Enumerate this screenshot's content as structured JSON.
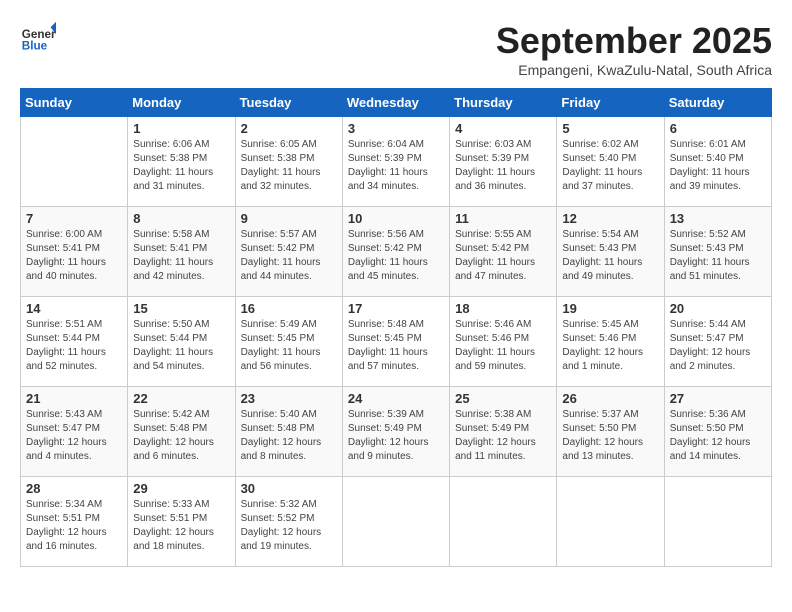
{
  "header": {
    "logo_general": "General",
    "logo_blue": "Blue",
    "month_title": "September 2025",
    "subtitle": "Empangeni, KwaZulu-Natal, South Africa"
  },
  "days_of_week": [
    "Sunday",
    "Monday",
    "Tuesday",
    "Wednesday",
    "Thursday",
    "Friday",
    "Saturday"
  ],
  "weeks": [
    [
      {
        "day": "",
        "info": ""
      },
      {
        "day": "1",
        "info": "Sunrise: 6:06 AM\nSunset: 5:38 PM\nDaylight: 11 hours\nand 31 minutes."
      },
      {
        "day": "2",
        "info": "Sunrise: 6:05 AM\nSunset: 5:38 PM\nDaylight: 11 hours\nand 32 minutes."
      },
      {
        "day": "3",
        "info": "Sunrise: 6:04 AM\nSunset: 5:39 PM\nDaylight: 11 hours\nand 34 minutes."
      },
      {
        "day": "4",
        "info": "Sunrise: 6:03 AM\nSunset: 5:39 PM\nDaylight: 11 hours\nand 36 minutes."
      },
      {
        "day": "5",
        "info": "Sunrise: 6:02 AM\nSunset: 5:40 PM\nDaylight: 11 hours\nand 37 minutes."
      },
      {
        "day": "6",
        "info": "Sunrise: 6:01 AM\nSunset: 5:40 PM\nDaylight: 11 hours\nand 39 minutes."
      }
    ],
    [
      {
        "day": "7",
        "info": "Sunrise: 6:00 AM\nSunset: 5:41 PM\nDaylight: 11 hours\nand 40 minutes."
      },
      {
        "day": "8",
        "info": "Sunrise: 5:58 AM\nSunset: 5:41 PM\nDaylight: 11 hours\nand 42 minutes."
      },
      {
        "day": "9",
        "info": "Sunrise: 5:57 AM\nSunset: 5:42 PM\nDaylight: 11 hours\nand 44 minutes."
      },
      {
        "day": "10",
        "info": "Sunrise: 5:56 AM\nSunset: 5:42 PM\nDaylight: 11 hours\nand 45 minutes."
      },
      {
        "day": "11",
        "info": "Sunrise: 5:55 AM\nSunset: 5:42 PM\nDaylight: 11 hours\nand 47 minutes."
      },
      {
        "day": "12",
        "info": "Sunrise: 5:54 AM\nSunset: 5:43 PM\nDaylight: 11 hours\nand 49 minutes."
      },
      {
        "day": "13",
        "info": "Sunrise: 5:52 AM\nSunset: 5:43 PM\nDaylight: 11 hours\nand 51 minutes."
      }
    ],
    [
      {
        "day": "14",
        "info": "Sunrise: 5:51 AM\nSunset: 5:44 PM\nDaylight: 11 hours\nand 52 minutes."
      },
      {
        "day": "15",
        "info": "Sunrise: 5:50 AM\nSunset: 5:44 PM\nDaylight: 11 hours\nand 54 minutes."
      },
      {
        "day": "16",
        "info": "Sunrise: 5:49 AM\nSunset: 5:45 PM\nDaylight: 11 hours\nand 56 minutes."
      },
      {
        "day": "17",
        "info": "Sunrise: 5:48 AM\nSunset: 5:45 PM\nDaylight: 11 hours\nand 57 minutes."
      },
      {
        "day": "18",
        "info": "Sunrise: 5:46 AM\nSunset: 5:46 PM\nDaylight: 11 hours\nand 59 minutes."
      },
      {
        "day": "19",
        "info": "Sunrise: 5:45 AM\nSunset: 5:46 PM\nDaylight: 12 hours\nand 1 minute."
      },
      {
        "day": "20",
        "info": "Sunrise: 5:44 AM\nSunset: 5:47 PM\nDaylight: 12 hours\nand 2 minutes."
      }
    ],
    [
      {
        "day": "21",
        "info": "Sunrise: 5:43 AM\nSunset: 5:47 PM\nDaylight: 12 hours\nand 4 minutes."
      },
      {
        "day": "22",
        "info": "Sunrise: 5:42 AM\nSunset: 5:48 PM\nDaylight: 12 hours\nand 6 minutes."
      },
      {
        "day": "23",
        "info": "Sunrise: 5:40 AM\nSunset: 5:48 PM\nDaylight: 12 hours\nand 8 minutes."
      },
      {
        "day": "24",
        "info": "Sunrise: 5:39 AM\nSunset: 5:49 PM\nDaylight: 12 hours\nand 9 minutes."
      },
      {
        "day": "25",
        "info": "Sunrise: 5:38 AM\nSunset: 5:49 PM\nDaylight: 12 hours\nand 11 minutes."
      },
      {
        "day": "26",
        "info": "Sunrise: 5:37 AM\nSunset: 5:50 PM\nDaylight: 12 hours\nand 13 minutes."
      },
      {
        "day": "27",
        "info": "Sunrise: 5:36 AM\nSunset: 5:50 PM\nDaylight: 12 hours\nand 14 minutes."
      }
    ],
    [
      {
        "day": "28",
        "info": "Sunrise: 5:34 AM\nSunset: 5:51 PM\nDaylight: 12 hours\nand 16 minutes."
      },
      {
        "day": "29",
        "info": "Sunrise: 5:33 AM\nSunset: 5:51 PM\nDaylight: 12 hours\nand 18 minutes."
      },
      {
        "day": "30",
        "info": "Sunrise: 5:32 AM\nSunset: 5:52 PM\nDaylight: 12 hours\nand 19 minutes."
      },
      {
        "day": "",
        "info": ""
      },
      {
        "day": "",
        "info": ""
      },
      {
        "day": "",
        "info": ""
      },
      {
        "day": "",
        "info": ""
      }
    ]
  ]
}
